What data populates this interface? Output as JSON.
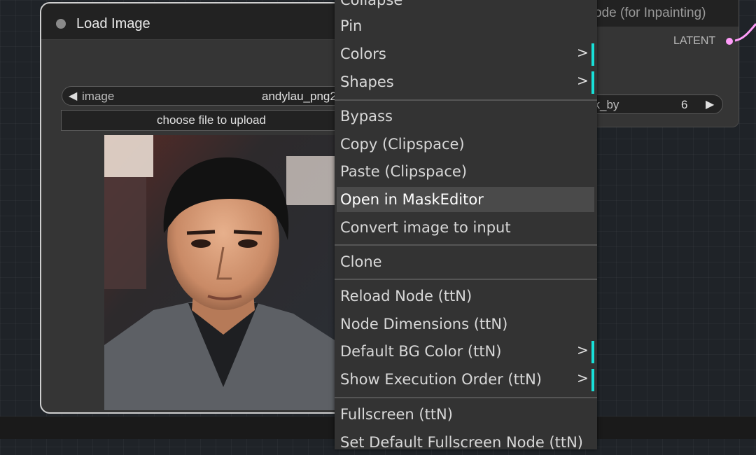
{
  "load_image_node": {
    "title": "Load Image",
    "image_widget": {
      "label": "image",
      "value": "andylau_png2"
    },
    "upload_button": "choose file to upload"
  },
  "inpaint_node": {
    "title": "ode (for Inpainting)",
    "output": "LATENT",
    "grow_widget": {
      "label": "sk_by",
      "value": "6"
    }
  },
  "context_menu": {
    "items": [
      {
        "label": "Collapse"
      },
      {
        "label": "Pin"
      },
      {
        "label": "Colors",
        "submenu": true
      },
      {
        "label": "Shapes",
        "submenu": true
      },
      {
        "label": "Bypass"
      },
      {
        "label": "Copy (Clipspace)"
      },
      {
        "label": "Paste (Clipspace)"
      },
      {
        "label": "Open in MaskEditor",
        "highlighted": true
      },
      {
        "label": "Convert image to input"
      },
      {
        "label": "Clone"
      },
      {
        "label": "Reload Node (ttN)"
      },
      {
        "label": "Node Dimensions (ttN)"
      },
      {
        "label": "Default BG Color (ttN)",
        "submenu": true
      },
      {
        "label": "Show Execution Order (ttN)",
        "submenu": true
      },
      {
        "label": "Fullscreen (ttN)"
      },
      {
        "label": "Set Default Fullscreen Node (ttN)"
      }
    ],
    "submenu_glyph": ">"
  },
  "colors": {
    "submenu_indicator": "#18e0d8",
    "latent_socket": "#ff9cf9",
    "selected_node_border": "#cfcfcf"
  }
}
